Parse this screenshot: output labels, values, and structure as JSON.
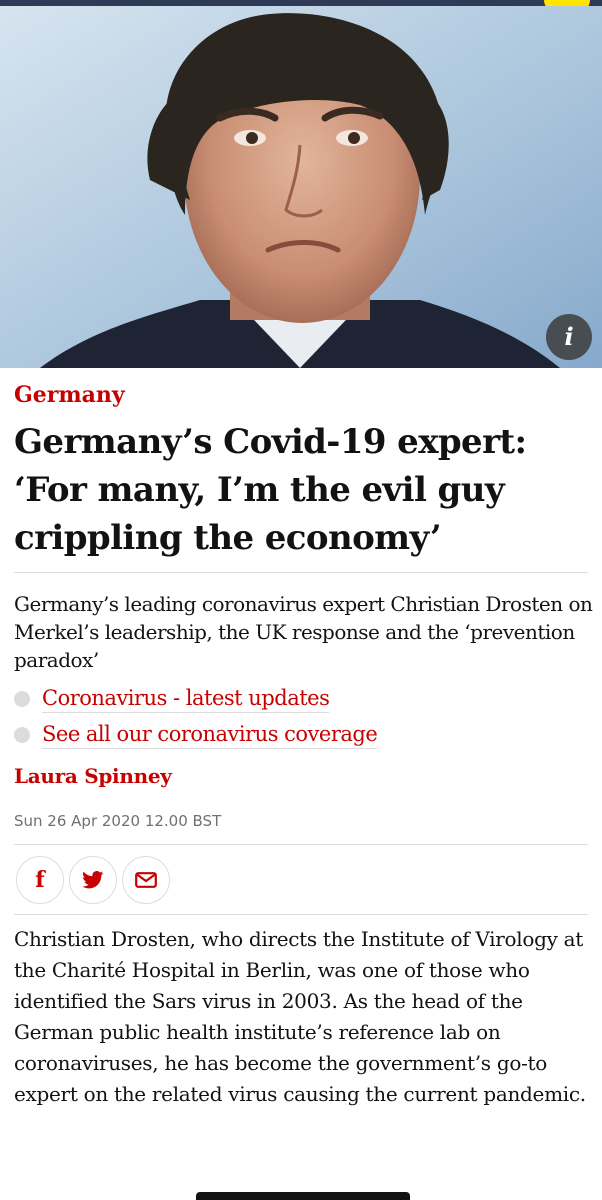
{
  "hero": {
    "image_alt": "Portrait of Christian Drosten",
    "info_button_label": "i"
  },
  "article": {
    "section": "Germany",
    "headline": "Germany’s Covid-19 expert: ‘For many, I’m the evil guy crippling the economy’",
    "standfirst": "Germany’s leading coronavirus expert Christian Drosten on Merkel’s leadership, the UK response and the ‘prevention paradox’",
    "related": [
      {
        "label": "Coronavirus - latest updates"
      },
      {
        "label": "See all our coronavirus coverage"
      }
    ],
    "byline": "Laura Spinney",
    "date": "Sun 26 Apr 2020 12.00 BST",
    "share": {
      "facebook_icon": "f",
      "twitter_icon": "twitter-bird",
      "email_icon": "envelope"
    },
    "body": "Christian Drosten, who directs the Institute of Virology at the Charité Hospital in Berlin, was one of those who identified the Sars virus in 2003. As the head of the German public health institute’s reference lab on coronaviruses, he has become the government’s go-to expert on the related virus causing the current pandemic."
  },
  "colors": {
    "accent_red": "#c70000",
    "divider": "#dcdcdc",
    "text": "#121212",
    "meta_grey": "#707070"
  }
}
